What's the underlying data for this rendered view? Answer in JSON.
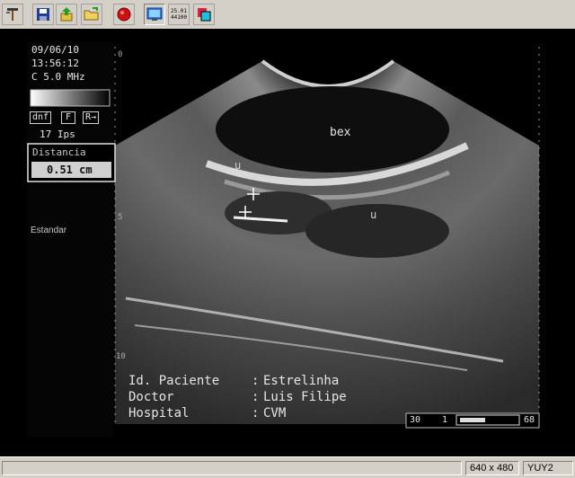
{
  "toolbar": {
    "buttons": [
      {
        "name": "settings-tools",
        "icon": "tools-icon"
      },
      {
        "name": "save",
        "icon": "floppy-disk-icon"
      },
      {
        "name": "export",
        "icon": "export-arrow-icon"
      },
      {
        "name": "open-folder",
        "icon": "folder-open-icon"
      },
      {
        "name": "record",
        "icon": "record-dot-icon"
      },
      {
        "name": "capture",
        "icon": "monitor-capture-icon"
      },
      {
        "name": "clock",
        "icon": "clock-icon"
      },
      {
        "name": "display-mode",
        "icon": "display-mode-icon"
      }
    ],
    "clock_line1": "25.01",
    "clock_line2": "44100"
  },
  "ultrasound": {
    "date": "09/06/10",
    "time": "13:56:12",
    "probe": "C 5.0 MHz",
    "btn_dnf": "dnf",
    "btn_f": "F",
    "btn_r": "R→",
    "frame_rate": "17 Ips",
    "measure_label": "Distancia",
    "measure_value": "0.51 cm",
    "preset": "Estandar",
    "labels": {
      "bex": "bex",
      "u_left": "u",
      "u_right": "u"
    },
    "patient_id_label": "Id. Paciente",
    "patient_id_value": "Estrelinha",
    "doctor_label": "Doctor",
    "doctor_value": "Luis Filipe",
    "hospital_label": "Hospital",
    "hospital_value": "CVM",
    "scale_left": "30",
    "scale_mid": "1",
    "scale_right": "68",
    "depth_top": "0",
    "depth_mid": "5",
    "depth_bottom": "10",
    "colon": ":"
  },
  "status": {
    "resolution": "640 x 480",
    "format": "YUY2"
  },
  "colors": {
    "chrome": "#d4d0c8",
    "record": "#d01010",
    "capture_blue": "#2a7ae0"
  }
}
